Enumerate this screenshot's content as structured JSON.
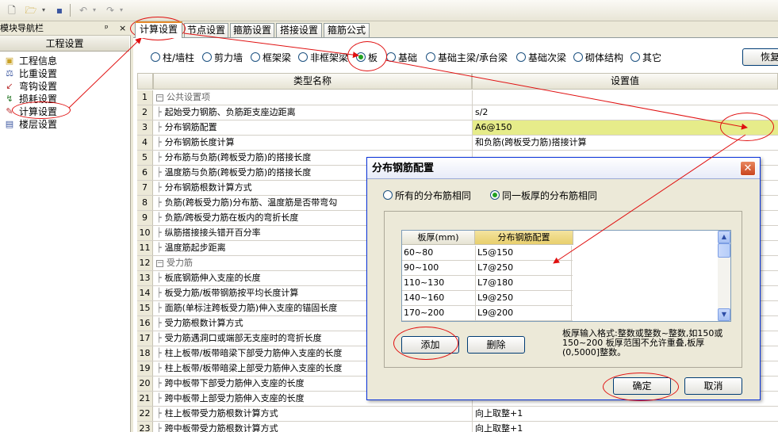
{
  "toolbar": {
    "buttons": [
      "new-doc-icon",
      "open-folder-icon",
      "dropdown-arrow-icon",
      "save-icon",
      "undo-icon",
      "dropdown-arrow-icon",
      "redo-icon",
      "dropdown-arrow-icon"
    ]
  },
  "nav": {
    "header": "模块导航栏",
    "pin": "ᵖ",
    "close": "×",
    "title": "工程设置",
    "items": [
      {
        "label": "工程信息",
        "icon": "project-info-icon"
      },
      {
        "label": "比重设置",
        "icon": "weight-icon"
      },
      {
        "label": "弯钩设置",
        "icon": "hook-icon"
      },
      {
        "label": "损耗设置",
        "icon": "loss-icon"
      },
      {
        "label": "计算设置",
        "icon": "calc-settings-icon"
      },
      {
        "label": "楼层设置",
        "icon": "floor-icon"
      }
    ]
  },
  "tabs": [
    "计算设置",
    "节点设置",
    "箍筋设置",
    "搭接设置",
    "箍筋公式"
  ],
  "radios": [
    "柱/墙柱",
    "剪力墙",
    "框架梁",
    "非框架梁",
    "板",
    "基础",
    "基础主梁/承台梁",
    "基础次梁",
    "砌体结构",
    "其它"
  ],
  "restore_label": "恢复",
  "grid": {
    "col_name": "类型名称",
    "col_value": "设置值",
    "rows": [
      {
        "n": "1",
        "name": "公共设置项",
        "value": "",
        "group": true
      },
      {
        "n": "2",
        "name": "起始受力钢筋、负筋距支座边距离",
        "value": "s/2"
      },
      {
        "n": "3",
        "name": "分布钢筋配置",
        "value": "A6@150"
      },
      {
        "n": "4",
        "name": "分布钢筋长度计算",
        "value": "和负筋(跨板受力筋)搭接计算"
      },
      {
        "n": "5",
        "name": "分布筋与负筋(跨板受力筋)的搭接长度",
        "value": ""
      },
      {
        "n": "6",
        "name": "温度筋与负筋(跨板受力筋)的搭接长度",
        "value": ""
      },
      {
        "n": "7",
        "name": "分布钢筋根数计算方式",
        "value": ""
      },
      {
        "n": "8",
        "name": "负筋(跨板受力筋)分布筋、温度筋是否带弯勾",
        "value": ""
      },
      {
        "n": "9",
        "name": "负筋/跨板受力筋在板内的弯折长度",
        "value": ""
      },
      {
        "n": "10",
        "name": "纵筋搭接接头错开百分率",
        "value": ""
      },
      {
        "n": "11",
        "name": "温度筋起步距离",
        "value": ""
      },
      {
        "n": "12",
        "name": "受力筋",
        "value": "",
        "group": true
      },
      {
        "n": "13",
        "name": "板底钢筋伸入支座的长度",
        "value": ""
      },
      {
        "n": "14",
        "name": "板受力筋/板带钢筋按平均长度计算",
        "value": ""
      },
      {
        "n": "15",
        "name": "面筋(单标注跨板受力筋)伸入支座的锚固长度",
        "value": ""
      },
      {
        "n": "16",
        "name": "受力筋根数计算方式",
        "value": ""
      },
      {
        "n": "17",
        "name": "受力筋遇洞口或端部无支座时的弯折长度",
        "value": ""
      },
      {
        "n": "18",
        "name": "柱上板带/板带暗梁下部受力筋伸入支座的长度",
        "value": ""
      },
      {
        "n": "19",
        "name": "柱上板带/板带暗梁上部受力筋伸入支座的长度",
        "value": ""
      },
      {
        "n": "20",
        "name": "跨中板带下部受力筋伸入支座的长度",
        "value": ""
      },
      {
        "n": "21",
        "name": "跨中板带上部受力筋伸入支座的长度",
        "value": ""
      },
      {
        "n": "22",
        "name": "柱上板带受力筋根数计算方式",
        "value": "向上取整+1"
      },
      {
        "n": "23",
        "name": "跨中板带受力筋根数计算方式",
        "value": "向上取整+1"
      }
    ]
  },
  "dialog": {
    "title": "分布钢筋配置",
    "close": "✕",
    "opt_all": "所有的分布筋相同",
    "opt_same_thickness": "同一板厚的分布筋相同",
    "col_thickness": "板厚(mm)",
    "col_config": "分布钢筋配置",
    "rows": [
      {
        "t": "60~80",
        "c": "L5@150"
      },
      {
        "t": "90~100",
        "c": "L7@250"
      },
      {
        "t": "110~130",
        "c": "L7@180"
      },
      {
        "t": "140~160",
        "c": "L9@250"
      },
      {
        "t": "170~200",
        "c": "L9@200"
      }
    ],
    "add": "添加",
    "delete": "删除",
    "hint": "板厚输入格式:整数或整数~整数,如150或150~200 板厚范围不允许重叠,板厚(0,5000]整数。",
    "ok": "确定",
    "cancel": "取消"
  }
}
